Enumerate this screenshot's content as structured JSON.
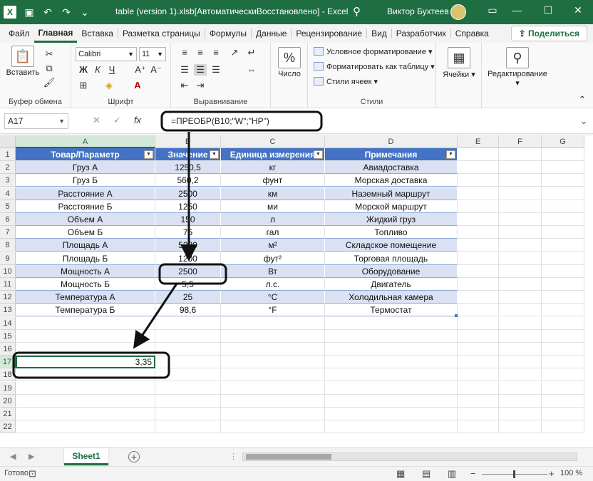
{
  "window": {
    "title": "table (version 1).xlsb[АвтоматическиВосстановлено]  -  Excel",
    "user": "Виктор Бухтеев",
    "minimize": "—",
    "maximize": "☐",
    "close": "✕"
  },
  "quick_access": [
    "save-icon",
    "undo-icon",
    "redo-icon",
    "customize-icon"
  ],
  "ribbon_tabs": [
    "Файл",
    "Главная",
    "Вставка",
    "Разметка страницы",
    "Формулы",
    "Данные",
    "Рецензирование",
    "Вид",
    "Разработчик",
    "Справка"
  ],
  "active_tab": "Главная",
  "share_label": "Поделиться",
  "ribbon": {
    "clipboard": {
      "paste_label": "Вставить",
      "group_label": "Буфер обмена"
    },
    "font": {
      "name": "Calibri",
      "size": "11",
      "group_label": "Шрифт",
      "bold": "Ж",
      "italic": "К",
      "underline": "Ч"
    },
    "alignment": {
      "group_label": "Выравнивание"
    },
    "number": {
      "label": "Число",
      "symbol": "%"
    },
    "styles": {
      "conditional": "Условное форматирование",
      "format_table": "Форматировать как таблицу",
      "cell_styles": "Стили ячеек",
      "group_label": "Стили"
    },
    "cells": {
      "label": "Ячейки"
    },
    "editing": {
      "label": "Редактирование"
    }
  },
  "formula_bar": {
    "name_box": "A17",
    "cancel": "✕",
    "enter": "✓",
    "fx": "fx",
    "formula": "=ПРЕОБР(B10;\"W\";\"HP\")"
  },
  "columns": [
    "A",
    "B",
    "C",
    "D",
    "E",
    "F",
    "G"
  ],
  "selected_column": "A",
  "rows": [
    "1",
    "2",
    "3",
    "4",
    "5",
    "6",
    "7",
    "8",
    "9",
    "10",
    "11",
    "12",
    "13",
    "14",
    "15",
    "16",
    "17",
    "18",
    "19",
    "20",
    "21",
    "22"
  ],
  "selected_row": "17",
  "table": {
    "headers": [
      "Товар/Параметр",
      "Значение",
      "Единица измерения",
      "Примечания"
    ],
    "rows": [
      [
        "Груз А",
        "1250,5",
        "кг",
        "Авиадоставка"
      ],
      [
        "Груз Б",
        "560,2",
        "фунт",
        "Морская доставка"
      ],
      [
        "Расстояние А",
        "2500",
        "км",
        "Наземный маршрут"
      ],
      [
        "Расстояние Б",
        "1250",
        "ми",
        "Морской маршрут"
      ],
      [
        "Объем А",
        "150",
        "л",
        "Жидкий груз"
      ],
      [
        "Объем Б",
        "75",
        "гал",
        "Топливо"
      ],
      [
        "Площадь А",
        "5280",
        "м²",
        "Складское помещение"
      ],
      [
        "Площадь Б",
        "1200",
        "фут²",
        "Торговая площадь"
      ],
      [
        "Мощность А",
        "2500",
        "Вт",
        "Оборудование"
      ],
      [
        "Мощность Б",
        "5,5",
        "л.с.",
        "Двигатель"
      ],
      [
        "Температура А",
        "25",
        "°C",
        "Холодильная камера"
      ],
      [
        "Температура Б",
        "98,6",
        "°F",
        "Термостат"
      ]
    ]
  },
  "result_cell": {
    "value": "3,35"
  },
  "sheet_tab": "Sheet1",
  "add_sheet": "+",
  "status": {
    "text": "Готово",
    "zoom": "100 %"
  }
}
